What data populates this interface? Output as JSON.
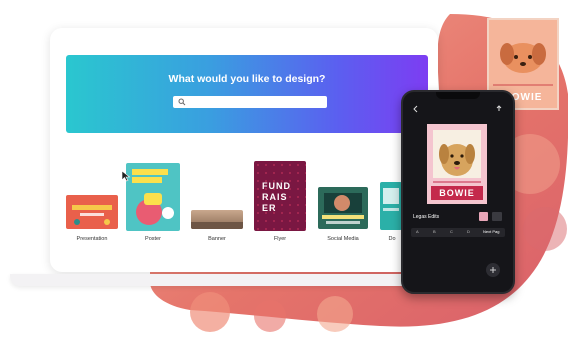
{
  "hero": {
    "title": "What would you like to design?",
    "search_placeholder": ""
  },
  "templates": [
    {
      "label": "Presentation"
    },
    {
      "label": "Poster"
    },
    {
      "label": "Banner"
    },
    {
      "label": "Flyer"
    },
    {
      "label": "Social Media"
    },
    {
      "label": "Do"
    }
  ],
  "flyer_text": [
    "FUND",
    "RAIS",
    "ER"
  ],
  "phone": {
    "poster_name": "BOWIE",
    "toolbar_label": "Legas Edits",
    "tabs": [
      "A",
      "B",
      "C",
      "D",
      "Next Pag"
    ]
  },
  "bg_card": {
    "name": "BOWIE"
  },
  "colors": {
    "hero_start": "#2ac7cf",
    "hero_end": "#7d3df2",
    "blob": "#e9806f",
    "phone_bg": "#151519",
    "poster_label": "#c4294c"
  }
}
